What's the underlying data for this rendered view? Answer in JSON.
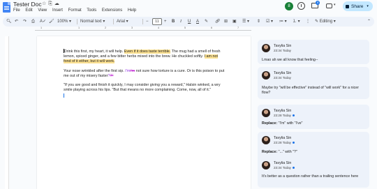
{
  "app": {
    "title": "Tester Doc",
    "menu": [
      "File",
      "Edit",
      "View",
      "Insert",
      "Format",
      "Tools",
      "Extensions",
      "Help"
    ],
    "account_initial": "8",
    "comment_count": "4",
    "share_label": "Share"
  },
  "toolbar": {
    "zoom": "100%",
    "style": "Normal text",
    "font": "Arial",
    "font_size": "11",
    "mode": "Editing"
  },
  "ruler": [
    "1",
    "1",
    "2",
    "3",
    "4",
    "5",
    "6",
    "7"
  ],
  "doc": {
    "p1": {
      "a": "Drink this first, my heart, it will help.",
      "hl1": "Even if it does taste terrible.",
      "b": "The mug had a smell of fresh lemon, spiced ginger, and a few bitter herbs mixed into the brew. He chuckled softly.",
      "hl2": "I am not fond of it either, but it will work."
    },
    "p2": {
      "a": "Your nose wrinkled after the first sip.",
      "ins1": "I'm",
      "del1": "I'm",
      "b": "not sure how torture is a cure. Or is this poison to put me out of my misery faster",
      "ins2": "?",
      "del2": "?\""
    },
    "p3": {
      "a": "\"If you are good and finish it quickly, I may consider giving you a reward,\" Halsin winked, a wry smile playing across his lips. \"But that means no more complaining. Come, now, all of it.\""
    }
  },
  "comments": [
    {
      "name": "Tavylia Sin",
      "time": "23:34 Today",
      "label": "",
      "text": "Lmao ah we all know that feeling--"
    },
    {
      "name": "Tavylia Sin",
      "time": "23:34 Today",
      "label": "",
      "text": "Maybe try \"will be effective\" instead of \"will work\" for a nicer flow?"
    },
    {
      "name": "Tavylia Sin",
      "time": "23:28 Today",
      "label": "Replace:",
      "text": "\"I'm\" with \"I've\""
    },
    {
      "name": "Tavylia Sin",
      "time": "23:28 Today",
      "label": "Replace:",
      "text": "\"...\" with \"?\""
    },
    {
      "name": "Tavylia Sin",
      "time": "23:34 Today",
      "label": "",
      "text": "It's better as a question rather than a trailing sentence here"
    }
  ]
}
